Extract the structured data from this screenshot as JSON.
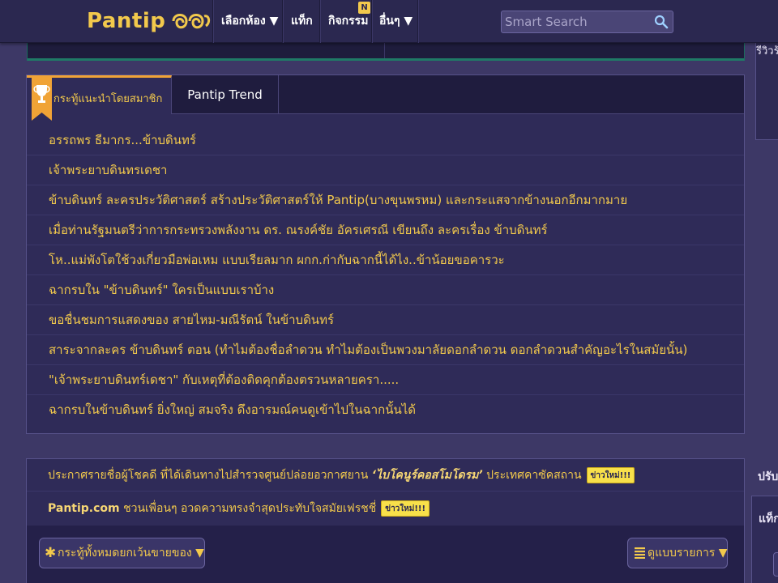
{
  "header": {
    "logo_text": "Pantip",
    "nav": [
      {
        "label": "เลือกห้อง ▼"
      },
      {
        "label": "แท็ก"
      },
      {
        "label": "กิจกรรม"
      },
      {
        "label": "อื่นๆ ▼"
      }
    ],
    "activity_badge": "N",
    "search_placeholder": "Smart Search"
  },
  "sidebar_right": {
    "top_label": "รีวิวร้",
    "bottom_label_1": "ปรับ",
    "bottom_label_2": "แท็ก"
  },
  "recommended": {
    "tabs": [
      {
        "label": "กระทู้แนะนำโดยสมาชิก",
        "active": true
      },
      {
        "label": "Pantip Trend",
        "active": false
      }
    ],
    "items": [
      "อรรถพร ธีมากร...ข้าบดินทร์",
      "เจ้าพระยาบดินทรเดชา",
      "ข้าบดินทร์ ละครประวัติศาสตร์ สร้างประวัติศาสตร์ให้ Pantip(บางขุนพรหม) และกระแสจากข้างนอกอีกมากมาย",
      "เมื่อท่านรัฐมนตรีว่าการกระทรวงพลังงาน ดร. ณรงค์ชัย อัครเศรณี เขียนถึง ละครเรื่อง ข้าบดินทร์",
      "โห..แม่พังโตใช้วงเกี่ยวมือพ่อเหม แบบเรียลมาก ผกก.ก่ากับฉากนี้ได้ไง..ข้าน้อยขอคารวะ",
      "ฉากรบใน \"ข้าบดินทร์\" ใครเป็นแบบเราบ้าง",
      "ขอชื่นชมการแสดงของ สายไหม-มณีรัตน์ ในข้าบดินทร์",
      "สาระจากละคร ข้าบดินทร์ ตอน (ทำไมต้องชื่อลำดวน ทำไมต้องเป็นพวงมาลัยดอกลำดวน ดอกลำดวนสำคัญอะไรในสมัยนั้น)",
      "\"เจ้าพระยาบดินทร์เดชา\" กับเหตุที่ต้องติดคุกต้องตรวนหลายครา.....",
      "ฉากรบในข้าบดินทร์ ยิ่งใหญ่ สมจริง ดึงอารมณ์คนดูเข้าไปในฉากนั้นได้"
    ]
  },
  "announcements": {
    "row1_prefix": "ประกาศรายชื่อผู้โชคดี ที่ได้เดินทางไปสำรวจศูนย์ปล่อยอวกาศยาน ",
    "row1_highlight": "‘ไบโคนูร์คอสโมโดรม’",
    "row1_suffix": " ประเทศคาซัคสถาน",
    "row2_bold": "Pantip.com",
    "row2_text": " ชวนเพื่อนๆ อวดความทรงจำสุดประทับใจสมัยเฟรชชี่",
    "new_badge": "ข่าวใหม่!!!",
    "filter_button": "กระทู้ทั้งหมดยกเว้นขายของ ▼",
    "view_button": "ดูแบบรายการ ▼"
  },
  "colors": {
    "background": "#3d3866",
    "header_bg": "#2b2850",
    "accent_yellow": "#f2c94c",
    "tab_orange": "#f0a336",
    "teal_border": "#1f7a66"
  }
}
